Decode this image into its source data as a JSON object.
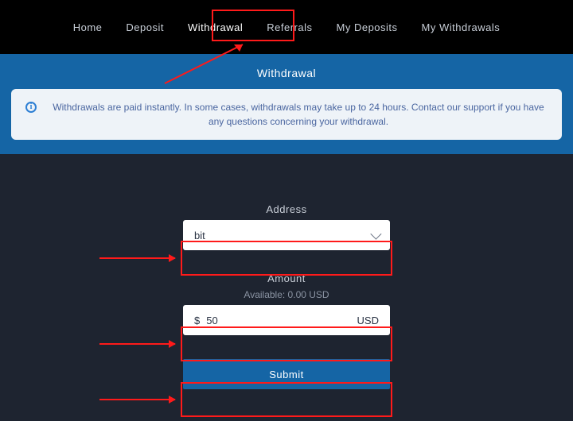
{
  "nav": {
    "home": "Home",
    "deposit": "Deposit",
    "withdrawal": "Withdrawal",
    "referrals": "Referrals",
    "my_deposits": "My Deposits",
    "my_withdrawals": "My Withdrawals"
  },
  "banner": {
    "title": "Withdrawal",
    "notice": "Withdrawals are paid instantly. In some cases, withdrawals may take up to 24 hours. Contact our support if you have any questions concerning your withdrawal."
  },
  "form": {
    "address_label": "Address",
    "address_value": "bit",
    "amount_label": "Amount",
    "available_text": "Available: 0.00 USD",
    "amount_prefix": "$",
    "amount_value": "50",
    "amount_suffix": "USD",
    "submit_label": "Submit"
  }
}
